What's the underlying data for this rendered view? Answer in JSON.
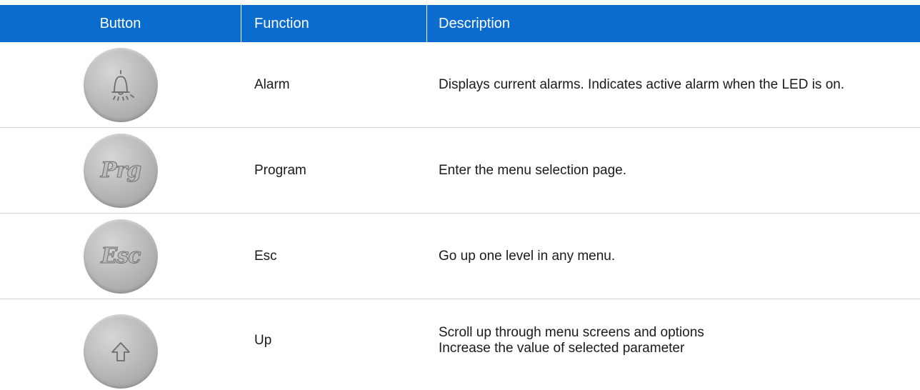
{
  "table": {
    "headers": {
      "button": "Button",
      "function": "Function",
      "description": "Description"
    },
    "rows": [
      {
        "icon": "bell-icon",
        "function": "Alarm",
        "description": "Displays current alarms. Indicates active alarm when the LED is on."
      },
      {
        "icon": "prg-icon",
        "label": "Prg",
        "function": "Program",
        "description": "Enter the menu selection page."
      },
      {
        "icon": "esc-icon",
        "label": "Esc",
        "function": "Esc",
        "description": "Go up one level in any menu."
      },
      {
        "icon": "arrow-up-icon",
        "function": "Up",
        "description_line1": "Scroll up through menu screens and options",
        "description_line2": "Increase the value of selected parameter"
      }
    ]
  },
  "colors": {
    "header_bg": "#0b6ccf",
    "header_text": "#ffffff",
    "divider": "#d9d9d9"
  }
}
